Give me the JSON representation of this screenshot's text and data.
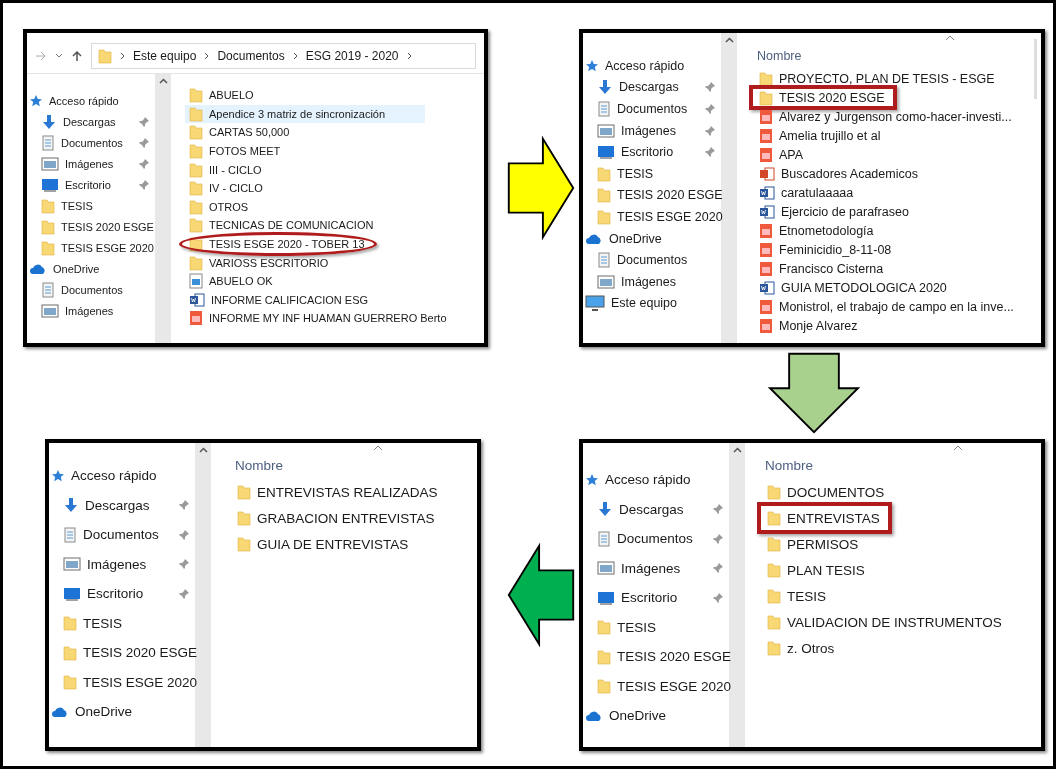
{
  "panels": [
    {
      "breadcrumb": [
        "Este equipo",
        "Documentos",
        "ESG 2019 - 2020"
      ],
      "sidebar": [
        {
          "kind": "quick",
          "label": "Acceso rápido",
          "pinned": false
        },
        {
          "kind": "downloads",
          "label": "Descargas",
          "pinned": true
        },
        {
          "kind": "documents",
          "label": "Documentos",
          "pinned": true
        },
        {
          "kind": "images",
          "label": "Imágenes",
          "pinned": true
        },
        {
          "kind": "desktop",
          "label": "Escritorio",
          "pinned": true
        },
        {
          "kind": "folder",
          "label": "TESIS",
          "pinned": false
        },
        {
          "kind": "folder",
          "label": "TESIS 2020 ESGE",
          "pinned": false
        },
        {
          "kind": "folder",
          "label": "TESIS ESGE 2020",
          "pinned": false
        },
        {
          "kind": "onedrive",
          "label": "OneDrive",
          "pinned": false
        },
        {
          "kind": "documents",
          "label": "Documentos",
          "pinned": false
        },
        {
          "kind": "images",
          "label": "Imágenes",
          "pinned": false
        }
      ],
      "items": [
        {
          "kind": "folder",
          "label": "ABUELO",
          "hovered": false,
          "circled": false
        },
        {
          "kind": "folder",
          "label": "Apendice 3 matriz de sincronización",
          "hovered": true,
          "circled": false
        },
        {
          "kind": "folder",
          "label": "CARTAS 50,000",
          "hovered": false,
          "circled": false
        },
        {
          "kind": "folder",
          "label": "FOTOS MEET",
          "hovered": false,
          "circled": false
        },
        {
          "kind": "folder",
          "label": "III - CICLO",
          "hovered": false,
          "circled": false
        },
        {
          "kind": "folder",
          "label": "IV - CICLO",
          "hovered": false,
          "circled": false
        },
        {
          "kind": "folder",
          "label": "OTROS",
          "hovered": false,
          "circled": false
        },
        {
          "kind": "folder",
          "label": "TECNICAS DE COMUNICACION",
          "hovered": false,
          "circled": false
        },
        {
          "kind": "folder",
          "label": "TESIS ESGE 2020 - TOBER 13",
          "hovered": false,
          "circled": true
        },
        {
          "kind": "folder",
          "label": "VARIOSS ESCRITORIO",
          "hovered": false,
          "circled": false
        },
        {
          "kind": "image",
          "label": "ABUELO OK",
          "hovered": false,
          "circled": false
        },
        {
          "kind": "word",
          "label": "INFORME CALIFICACION ESG",
          "hovered": false,
          "circled": false
        },
        {
          "kind": "pdf",
          "label": "INFORME MY INF HUAMAN GUERRERO Berto",
          "hovered": false,
          "circled": false
        }
      ]
    },
    {
      "column_header": "Nombre",
      "sidebar": [
        {
          "kind": "quick",
          "label": "Acceso rápido",
          "pinned": false
        },
        {
          "kind": "downloads",
          "label": "Descargas",
          "pinned": true
        },
        {
          "kind": "documents",
          "label": "Documentos",
          "pinned": true
        },
        {
          "kind": "images",
          "label": "Imágenes",
          "pinned": true
        },
        {
          "kind": "desktop",
          "label": "Escritorio",
          "pinned": true
        },
        {
          "kind": "folder",
          "label": "TESIS",
          "pinned": false
        },
        {
          "kind": "folder",
          "label": "TESIS 2020 ESGE",
          "pinned": false
        },
        {
          "kind": "folder",
          "label": "TESIS ESGE 2020",
          "pinned": false
        },
        {
          "kind": "onedrive",
          "label": "OneDrive",
          "pinned": false
        },
        {
          "kind": "documents",
          "label": "Documentos",
          "pinned": false
        },
        {
          "kind": "images",
          "label": "Imágenes",
          "pinned": false
        },
        {
          "kind": "pc",
          "label": "Este equipo",
          "pinned": false
        }
      ],
      "items": [
        {
          "kind": "folder",
          "label": "PROYECTO, PLAN DE TESIS - ESGE",
          "boxed": false
        },
        {
          "kind": "folder",
          "label": "TESIS 2020 ESGE",
          "boxed": true
        },
        {
          "kind": "pdf",
          "label": "Alvarez y Jurgenson como-hacer-investi...",
          "boxed": false
        },
        {
          "kind": "pdf",
          "label": "Amelia trujillo et al",
          "boxed": false
        },
        {
          "kind": "pdf",
          "label": "APA",
          "boxed": false
        },
        {
          "kind": "ppt",
          "label": "Buscadores Academicos",
          "boxed": false
        },
        {
          "kind": "word",
          "label": "caratulaaaaa",
          "boxed": false
        },
        {
          "kind": "word",
          "label": "Ejercicio de parafraseo",
          "boxed": false
        },
        {
          "kind": "pdf",
          "label": "Etnometodología",
          "boxed": false
        },
        {
          "kind": "pdf",
          "label": "Feminicidio_8-11-08",
          "boxed": false
        },
        {
          "kind": "pdf",
          "label": "Francisco Cisterna",
          "boxed": false
        },
        {
          "kind": "word",
          "label": "GUIA METODOLOGICA 2020",
          "boxed": false
        },
        {
          "kind": "pdf",
          "label": "Monistrol, el trabajo de campo en la inve...",
          "boxed": false
        },
        {
          "kind": "pdf",
          "label": "Monje Alvarez",
          "boxed": false
        }
      ]
    },
    {
      "column_header": "Nombre",
      "sidebar": [
        {
          "kind": "quick",
          "label": "Acceso rápido",
          "pinned": false
        },
        {
          "kind": "downloads",
          "label": "Descargas",
          "pinned": true
        },
        {
          "kind": "documents",
          "label": "Documentos",
          "pinned": true
        },
        {
          "kind": "images",
          "label": "Imágenes",
          "pinned": true
        },
        {
          "kind": "desktop",
          "label": "Escritorio",
          "pinned": true
        },
        {
          "kind": "folder",
          "label": "TESIS",
          "pinned": false
        },
        {
          "kind": "folder",
          "label": "TESIS 2020 ESGE",
          "pinned": false
        },
        {
          "kind": "folder",
          "label": "TESIS ESGE 2020",
          "pinned": false
        },
        {
          "kind": "onedrive",
          "label": "OneDrive",
          "pinned": false
        }
      ],
      "items": [
        {
          "kind": "folder",
          "label": "ENTREVISTAS REALIZADAS"
        },
        {
          "kind": "folder",
          "label": "GRABACION ENTREVISTAS"
        },
        {
          "kind": "folder",
          "label": "GUIA DE ENTREVISTAS"
        }
      ]
    },
    {
      "column_header": "Nombre",
      "sidebar": [
        {
          "kind": "quick",
          "label": "Acceso rápido",
          "pinned": false
        },
        {
          "kind": "downloads",
          "label": "Descargas",
          "pinned": true
        },
        {
          "kind": "documents",
          "label": "Documentos",
          "pinned": true
        },
        {
          "kind": "images",
          "label": "Imágenes",
          "pinned": true
        },
        {
          "kind": "desktop",
          "label": "Escritorio",
          "pinned": true
        },
        {
          "kind": "folder",
          "label": "TESIS",
          "pinned": false
        },
        {
          "kind": "folder",
          "label": "TESIS 2020 ESGE",
          "pinned": false
        },
        {
          "kind": "folder",
          "label": "TESIS ESGE 2020",
          "pinned": false
        },
        {
          "kind": "onedrive",
          "label": "OneDrive",
          "pinned": false
        }
      ],
      "items": [
        {
          "kind": "folder",
          "label": "DOCUMENTOS",
          "boxed": false
        },
        {
          "kind": "folder",
          "label": "ENTREVISTAS",
          "boxed": true
        },
        {
          "kind": "folder",
          "label": "PERMISOS",
          "boxed": false
        },
        {
          "kind": "folder",
          "label": "PLAN TESIS",
          "boxed": false
        },
        {
          "kind": "folder",
          "label": "TESIS",
          "boxed": false
        },
        {
          "kind": "folder",
          "label": "VALIDACION DE INSTRUMENTOS",
          "boxed": false
        },
        {
          "kind": "folder",
          "label": "z. Otros",
          "boxed": false
        }
      ]
    }
  ],
  "arrows": [
    {
      "kind": "right",
      "color": "#ffff00"
    },
    {
      "kind": "down",
      "color": "#a9d18e"
    },
    {
      "kind": "left",
      "color": "#00b050"
    }
  ]
}
